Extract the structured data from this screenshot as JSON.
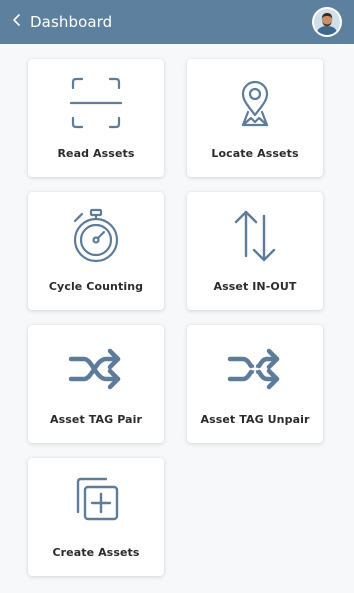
{
  "header": {
    "title": "Dashboard",
    "back_icon": "chevron-left-icon",
    "avatar_icon": "user-avatar",
    "background": "#5d809e"
  },
  "menu": {
    "icon_color": "#5d7c9a",
    "items": [
      {
        "label": "Read Assets",
        "icon": "scan-frame-icon"
      },
      {
        "label": "Locate Assets",
        "icon": "map-pin-icon"
      },
      {
        "label": "Cycle Counting",
        "icon": "stopwatch-icon"
      },
      {
        "label": "Asset IN-OUT",
        "icon": "up-down-arrows-icon"
      },
      {
        "label": "Asset TAG Pair",
        "icon": "shuffle-icon"
      },
      {
        "label": "Asset TAG Unpair",
        "icon": "shuffle-broken-icon"
      },
      {
        "label": "Create Assets",
        "icon": "copy-add-icon"
      }
    ]
  }
}
